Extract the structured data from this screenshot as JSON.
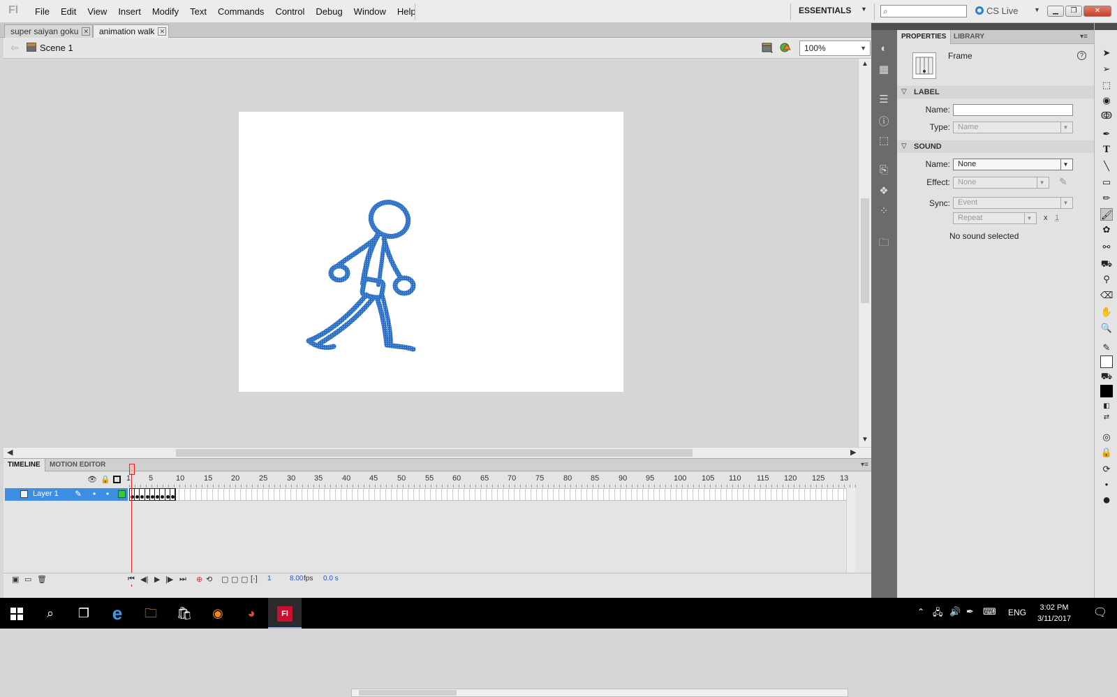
{
  "app": {
    "logo": "Fl",
    "workspace": "ESSENTIALS",
    "cs_live": "CS Live"
  },
  "menu": [
    "File",
    "Edit",
    "View",
    "Insert",
    "Modify",
    "Text",
    "Commands",
    "Control",
    "Debug",
    "Window",
    "Help"
  ],
  "document_tabs": [
    {
      "label": "super saiyan goku",
      "active": false
    },
    {
      "label": "animation walk",
      "active": true
    }
  ],
  "editbar": {
    "scene": "Scene 1",
    "zoom": "100%"
  },
  "timeline": {
    "tabs": [
      "TIMELINE",
      "MOTION EDITOR"
    ],
    "ruler": [
      "1",
      "5",
      "10",
      "15",
      "20",
      "25",
      "30",
      "35",
      "40",
      "45",
      "50",
      "55",
      "60",
      "65",
      "70",
      "75",
      "80",
      "85",
      "90",
      "95",
      "100",
      "105",
      "110",
      "115",
      "120",
      "125",
      "13"
    ],
    "layer": "Layer 1",
    "keyframe_count": 9,
    "status": {
      "current_frame": "1",
      "fps": "8.00",
      "fps_unit": "fps",
      "elapsed": "0.0 s"
    }
  },
  "properties": {
    "tabs": [
      "PROPERTIES",
      "LIBRARY"
    ],
    "target": "Frame",
    "label_section": "LABEL",
    "name_label": "Name:",
    "name_value": "",
    "type_label": "Type:",
    "type_value": "Name",
    "sound_section": "SOUND",
    "sound_name_label": "Name:",
    "sound_name_value": "None",
    "effect_label": "Effect:",
    "effect_value": "None",
    "sync_label": "Sync:",
    "sync_value": "Event",
    "repeat_value": "Repeat",
    "repeat_x": "x",
    "repeat_count": "1",
    "no_sound": "No sound selected"
  },
  "taskbar": {
    "lang": "ENG",
    "time": "3:02 PM",
    "date": "3/11/2017"
  },
  "colors": {
    "stroke": "#2a6fc4",
    "layer_highlight": "#3d8ee0",
    "playhead": "#e02222"
  }
}
